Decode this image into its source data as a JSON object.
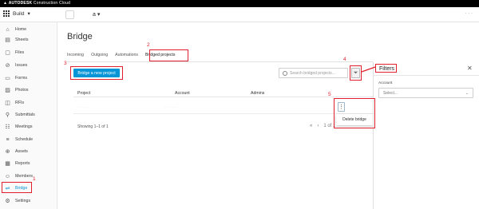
{
  "brand": {
    "autodesk": "AUTODESK",
    "product": "Construction Cloud"
  },
  "header": {
    "module": "Build",
    "project": "a"
  },
  "sidebar": {
    "items": [
      {
        "label": "Home",
        "icon": "home-icon",
        "glyph": "⌂"
      },
      {
        "label": "Sheets",
        "icon": "sheets-icon",
        "glyph": "▤"
      },
      {
        "label": "Files",
        "icon": "files-icon",
        "glyph": "▢"
      },
      {
        "label": "Issues",
        "icon": "issues-icon",
        "glyph": "⊘"
      },
      {
        "label": "Forms",
        "icon": "forms-icon",
        "glyph": "▭"
      },
      {
        "label": "Photos",
        "icon": "photos-icon",
        "glyph": "▨"
      },
      {
        "label": "RFIs",
        "icon": "rfis-icon",
        "glyph": "◫"
      },
      {
        "label": "Submittals",
        "icon": "submittals-icon",
        "glyph": "⚲"
      },
      {
        "label": "Meetings",
        "icon": "meetings-icon",
        "glyph": "☷"
      },
      {
        "label": "Schedule",
        "icon": "schedule-icon",
        "glyph": "≡"
      },
      {
        "label": "Assets",
        "icon": "assets-icon",
        "glyph": "⊕"
      },
      {
        "label": "Reports",
        "icon": "reports-icon",
        "glyph": "▦"
      },
      {
        "label": "Members",
        "icon": "members-icon",
        "glyph": "☺"
      },
      {
        "label": "Bridge",
        "icon": "bridge-icon",
        "glyph": "⇌"
      },
      {
        "label": "Settings",
        "icon": "settings-icon",
        "glyph": "⚙"
      }
    ]
  },
  "main": {
    "title": "Bridge",
    "tabs": [
      "Incoming",
      "Outgoing",
      "Automations",
      "Bridged projects"
    ],
    "bridge_button": "Bridge a new project",
    "search_placeholder": "Search bridged projects...",
    "columns": [
      "Project",
      "Account",
      "Admins"
    ],
    "row_menu": "Delete bridge",
    "pagination": "Showing 1–1 of 1",
    "page_indicator": "1 of 1"
  },
  "filters": {
    "title": "Filters",
    "account_label": "Account",
    "select_placeholder": "Select..."
  },
  "callouts": [
    "1",
    "2",
    "3",
    "4",
    "5"
  ],
  "colors": {
    "accent": "#0696d7",
    "callout": "#e0202c"
  }
}
